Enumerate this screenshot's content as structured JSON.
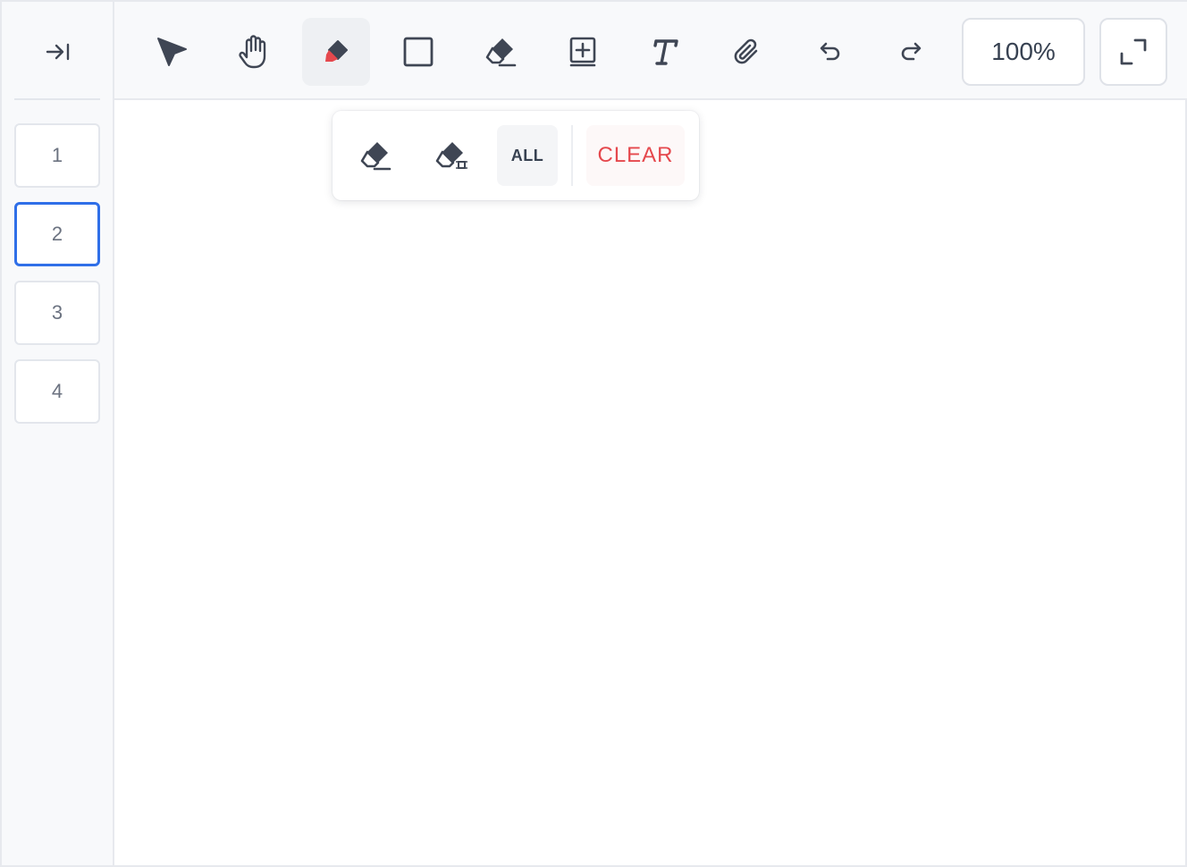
{
  "sidebar": {
    "collapse_icon": "collapse-to-right-icon",
    "pages": [
      {
        "label": "1",
        "active": false
      },
      {
        "label": "2",
        "active": true
      },
      {
        "label": "3",
        "active": false
      },
      {
        "label": "4",
        "active": false
      }
    ]
  },
  "toolbar": {
    "tools": [
      {
        "name": "select",
        "icon": "cursor-arrow-icon",
        "active": false
      },
      {
        "name": "pan",
        "icon": "hand-icon",
        "active": false
      },
      {
        "name": "highlighter",
        "icon": "highlighter-icon",
        "active": true
      },
      {
        "name": "rectangle",
        "icon": "square-icon",
        "active": false
      },
      {
        "name": "eraser",
        "icon": "eraser-icon",
        "active": false
      },
      {
        "name": "add-page",
        "icon": "add-page-icon",
        "active": false
      },
      {
        "name": "text",
        "icon": "text-icon",
        "active": false
      },
      {
        "name": "attach",
        "icon": "paperclip-icon",
        "active": false
      },
      {
        "name": "undo",
        "icon": "undo-icon",
        "active": false
      },
      {
        "name": "redo",
        "icon": "redo-icon",
        "active": false
      }
    ],
    "zoom_label": "100%",
    "fullscreen_icon": "fullscreen-icon"
  },
  "popover": {
    "eraser_icon": "eraser-icon",
    "area_eraser_icon": "area-eraser-icon",
    "all_label": "ALL",
    "clear_label": "CLEAR"
  },
  "colors": {
    "accent": "#2f6fe8",
    "highlighter_tip": "#e5484d",
    "clear_text": "#e5484d",
    "icon": "#3f4654"
  }
}
